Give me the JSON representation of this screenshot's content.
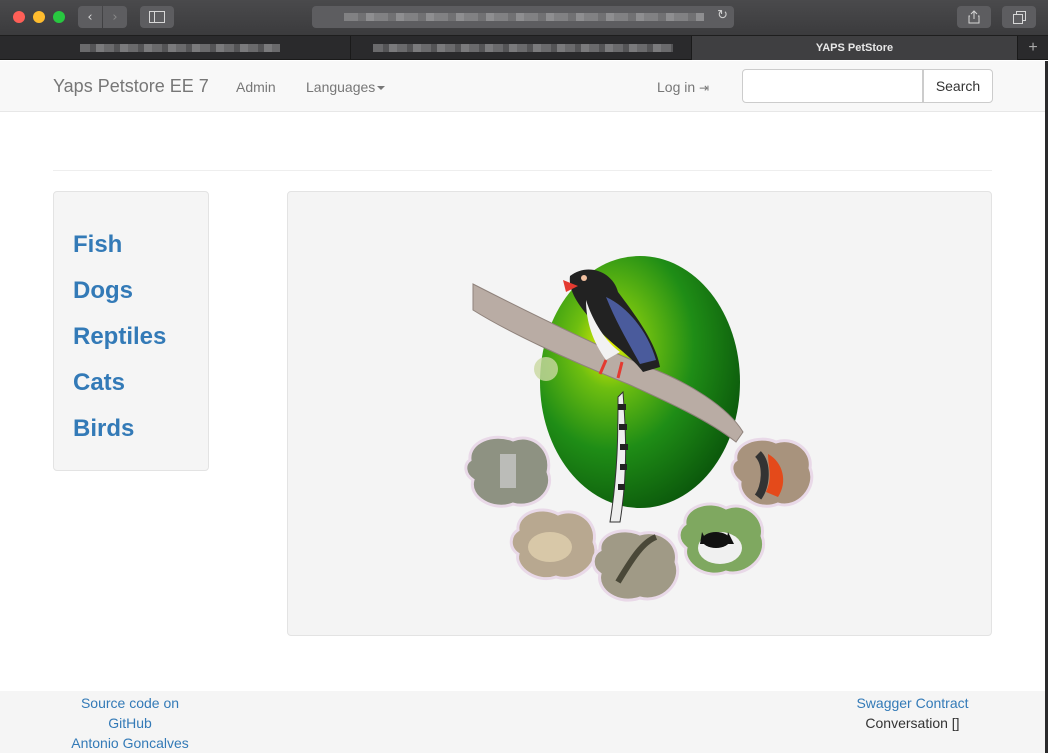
{
  "browser": {
    "active_tab_title": "YAPS PetStore",
    "new_tab_label": "+"
  },
  "navbar": {
    "brand": "Yaps Petstore EE 7",
    "admin": "Admin",
    "languages": "Languages",
    "login": "Log in",
    "search_placeholder": "",
    "search_button": "Search"
  },
  "categories": [
    "Fish",
    "Dogs",
    "Reptiles",
    "Cats",
    "Birds"
  ],
  "footer": {
    "source_line1": "Source code on",
    "source_line2": "GitHub",
    "author": "Antonio Goncalves",
    "swagger": "Swagger Contract",
    "conversation": "Conversation []"
  },
  "colors": {
    "link": "#337ab7",
    "navbar_bg": "#f8f8f8",
    "panel_bg": "#f5f5f5"
  }
}
